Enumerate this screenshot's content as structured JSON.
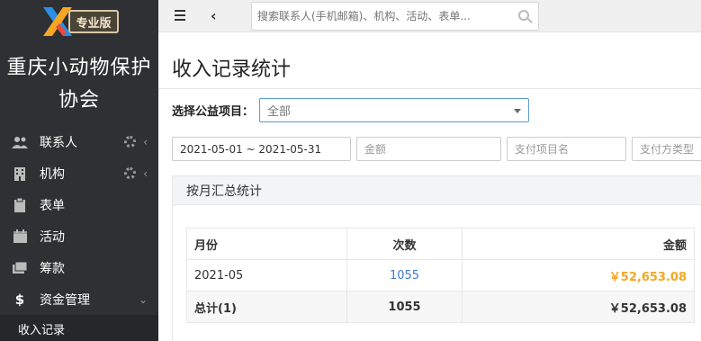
{
  "logo": {
    "badge": "专业版"
  },
  "org": {
    "name": "重庆小动物保护协会"
  },
  "nav": {
    "items": [
      {
        "label": "联系人",
        "icon": "users-icon",
        "has_settings": true
      },
      {
        "label": "机构",
        "icon": "building-icon",
        "has_settings": true
      },
      {
        "label": "表单",
        "icon": "clipboard-icon"
      },
      {
        "label": "活动",
        "icon": "calendar-icon"
      },
      {
        "label": "筹款",
        "icon": "money-icon"
      },
      {
        "label": "资金管理",
        "icon": "dollar-icon"
      }
    ],
    "sub_items": [
      {
        "label": "收入记录"
      }
    ]
  },
  "topbar": {
    "search_placeholder": "搜索联系人(手机邮箱)、机构、活动、表单..."
  },
  "page": {
    "title": "收入记录统计",
    "filter_label": "选择公益项目：",
    "filter_value": "全部",
    "date_range": "2021-05-01 ~ 2021-05-31",
    "amount_placeholder": "金额",
    "pay_item_placeholder": "支付项目名",
    "pay_type_placeholder": "支付方类型"
  },
  "panel": {
    "title": "按月汇总统计",
    "columns": {
      "month": "月份",
      "count": "次数",
      "amount": "金额"
    },
    "rows": [
      {
        "month": "2021-05",
        "count": "1055",
        "amount": "￥52,653.08"
      }
    ],
    "total": {
      "label": "总计(1)",
      "count": "1055",
      "amount": "￥52,653.08"
    }
  },
  "colors": {
    "sidebar_bg": "#2f3033",
    "link": "#3a7bd5",
    "amount_highlight": "#f5a623"
  }
}
